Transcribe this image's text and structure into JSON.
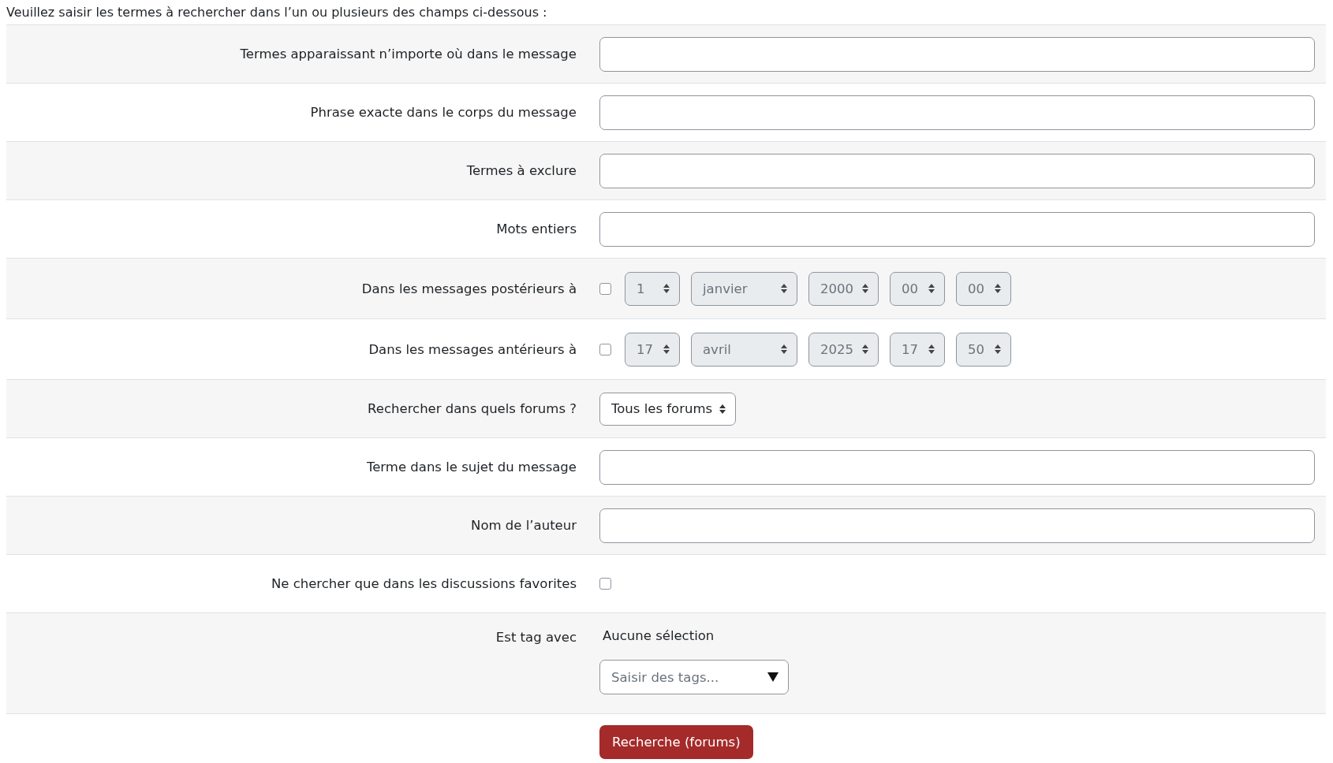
{
  "intro": "Veuillez saisir les termes à rechercher dans l’un ou plusieurs des champs ci-dessous :",
  "rows": [
    {
      "kind": "text",
      "label": "Termes apparaissant n’importe où dans le message"
    },
    {
      "kind": "text",
      "label": "Phrase exacte dans le corps du message"
    },
    {
      "kind": "text",
      "label": "Termes à exclure"
    },
    {
      "kind": "text",
      "label": "Mots entiers"
    },
    {
      "kind": "date",
      "label": "Dans les messages postérieurs à",
      "checked": false,
      "selects": [
        "1",
        "janvier",
        "2000",
        "00",
        "00"
      ]
    },
    {
      "kind": "date",
      "label": "Dans les messages antérieurs à",
      "checked": false,
      "selects": [
        "17",
        "avril",
        "2025",
        "17",
        "50"
      ]
    },
    {
      "kind": "select",
      "label": "Rechercher dans quels forums ?",
      "value": "Tous les forums"
    },
    {
      "kind": "text",
      "label": "Terme dans le sujet du message"
    },
    {
      "kind": "text",
      "label": "Nom de l’auteur"
    },
    {
      "kind": "checkbox",
      "label": "Ne chercher que dans les discussions favorites",
      "checked": false
    },
    {
      "kind": "tags",
      "label": "Est tag avec",
      "note": "Aucune sélection",
      "placeholder": "Saisir des tags..."
    }
  ],
  "submit": "Recherche (forums)"
}
